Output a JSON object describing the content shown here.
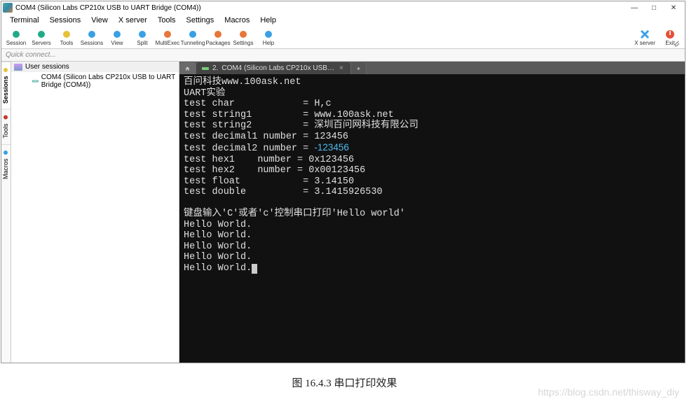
{
  "window": {
    "title": "COM4  (Silicon Labs CP210x USB to UART Bridge (COM4))"
  },
  "menu": [
    "Terminal",
    "Sessions",
    "View",
    "X server",
    "Tools",
    "Settings",
    "Macros",
    "Help"
  ],
  "toolbar": [
    {
      "label": "Session",
      "color": "#2a8"
    },
    {
      "label": "Servers",
      "color": "#2a8"
    },
    {
      "label": "Tools",
      "color": "#e6c23a"
    },
    {
      "label": "Sessions",
      "color": "#3aa0e6"
    },
    {
      "label": "View",
      "color": "#3aa0e6"
    },
    {
      "label": "Split",
      "color": "#3aa0e6"
    },
    {
      "label": "MultiExec",
      "color": "#e6773a"
    },
    {
      "label": "Tunneling",
      "color": "#3aa0e6"
    },
    {
      "label": "Packages",
      "color": "#e6773a"
    },
    {
      "label": "Settings",
      "color": "#e6773a"
    },
    {
      "label": "Help",
      "color": "#3aa0e6"
    }
  ],
  "toolbar_right": [
    {
      "label": "X server",
      "color": "#3a9ee6",
      "icon": "x",
      "x_bg": "#3aa0e6"
    },
    {
      "label": "Exit",
      "color": "#e6503a",
      "icon": "exit"
    }
  ],
  "quick_connect_placeholder": "Quick connect...",
  "side_tabs": [
    {
      "label": "Sessions",
      "dot": "#e6c23a"
    },
    {
      "label": "Tools",
      "dot": "#c0392b"
    },
    {
      "label": "Macros",
      "dot": "#3aa0e6"
    }
  ],
  "tree": {
    "root_label": "User sessions",
    "item_label": "COM4  (Silicon Labs CP210x USB to UART Bridge (COM4))"
  },
  "term_tab": {
    "index": "2.",
    "label": "COM4  (Silicon Labs CP210x USB…"
  },
  "terminal": {
    "lines": [
      "百问科技www.100ask.net",
      "UART实验",
      "test char            = H,c",
      "test string1         = www.100ask.net",
      "test string2         = 深圳百问网科技有限公司",
      "test decimal1 number = 123456"
    ],
    "neg_line_prefix": "test decimal2 number = ",
    "neg_value": "-123456",
    "lines2": [
      "test hex1    number = 0x123456",
      "test hex2    number = 0x00123456",
      "test float           = 3.14150",
      "test double          = 3.1415926530",
      "",
      "键盘输入'C'或者'c'控制串口打印'Hello world'",
      "Hello World.",
      "Hello World.",
      "Hello World.",
      "Hello World."
    ],
    "last_line": "Hello World."
  },
  "caption": "图 16.4.3 串口打印效果",
  "watermark": "https://blog.csdn.net/thisway_diy"
}
